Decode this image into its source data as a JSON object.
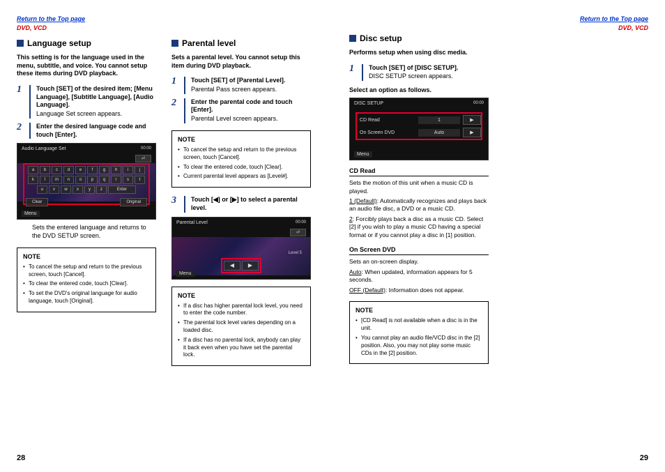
{
  "header": {
    "return_link": "Return to the Top page",
    "section": "DVD, VCD"
  },
  "left_page": {
    "page_number": "28",
    "col1": {
      "title": "Language setup",
      "intro": "This setting is for the language used in the menu, subtitle, and voice. You cannot setup these items during DVD playback.",
      "step1_main": "Touch [SET] of the desired item; [Menu Language], [Subtitle Language], [Audio Language].",
      "step1_sub": "Language Set screen appears.",
      "step2_main": "Enter the desired language code and touch [Enter].",
      "shot": {
        "title": "Audio Language Set",
        "time": "00:00",
        "back": "⏎",
        "r1": [
          "a",
          "b",
          "c",
          "d",
          "e",
          "f",
          "g",
          "h",
          "i",
          "j"
        ],
        "r2": [
          "k",
          "l",
          "m",
          "n",
          "o",
          "p",
          "q",
          "r",
          "s",
          "t"
        ],
        "r3_left": [
          "u",
          "v",
          "w",
          "x",
          "y",
          "z"
        ],
        "enter": "Enter",
        "clear": "Clear",
        "original": "Original",
        "menu": "Menu"
      },
      "after_shot": "Sets the entered language and returns to the DVD SETUP screen.",
      "note_head": "NOTE",
      "notes": [
        "To cancel the setup and return to the previous screen, touch [Cancel].",
        "To clear the entered code, touch [Clear].",
        "To set the DVD's original language for audio language, touch [Original]."
      ]
    },
    "col2": {
      "title": "Parental level",
      "intro": "Sets a parental level. You cannot setup this item during DVD playback.",
      "step1_main": "Touch [SET] of [Parental Level].",
      "step1_sub": "Parental Pass screen appears.",
      "step2_main": "Enter the parental code and touch [Enter].",
      "step2_sub": "Parental Level screen appears.",
      "note1_head": "NOTE",
      "notes1": [
        "To cancel the setup and return to the previous screen, touch [Cancel].",
        "To clear the entered code, touch [Clear].",
        "Current parental level appears as [Level#]."
      ],
      "step3_main": "Touch [◀] or [▶] to select a parental level.",
      "shot": {
        "title": "Parental Level",
        "time": "00:00",
        "back": "⏎",
        "level": "Level 5",
        "menu": "Menu"
      },
      "note2_head": "NOTE",
      "notes2": [
        "If a disc has higher parental lock level, you need to enter the code number.",
        "The parental lock level varies depending on a loaded disc.",
        "If a disc has no parental lock, anybody can play it back even when you have set the parental lock."
      ]
    }
  },
  "right_page": {
    "page_number": "29",
    "title": "Disc setup",
    "intro": "Performs setup when using disc media.",
    "step1_main": "Touch [SET] of [DISC SETUP].",
    "step1_sub": "DISC SETUP screen appears.",
    "select_line": "Select an option as follows.",
    "shot": {
      "title": "DISC SETUP",
      "time": "00:00",
      "r1_label": "CD Read",
      "r1_val": "1",
      "r2_label": "On Screen DVD",
      "r2_val": "Auto",
      "menu": "Menu"
    },
    "cd": {
      "head": "CD Read",
      "intro": "Sets the motion of this unit when a music CD is played.",
      "l1": "1 (Default)",
      "t1": ": Automatically recognizes and plays back an audio file disc, a DVD or a music CD.",
      "l2": "2",
      "t2": ": Forcibly plays back a disc as a music CD. Select [2] if you wish to play a music CD having a special format or if you cannot play a disc in [1] position."
    },
    "osd": {
      "head": "On Screen DVD",
      "intro": "Sets an on-screen display.",
      "l1": "Auto",
      "t1": ": When updated, information appears for 5 seconds.",
      "l2": "OFF (Default)",
      "t2": ": Information does not appear."
    },
    "note_head": "NOTE",
    "notes": [
      "[CD Read] is not available when a disc is in the unit.",
      "You cannot play an audio file/VCD disc in the [2] position. Also, you may not play some music CDs in the [2] position."
    ]
  }
}
